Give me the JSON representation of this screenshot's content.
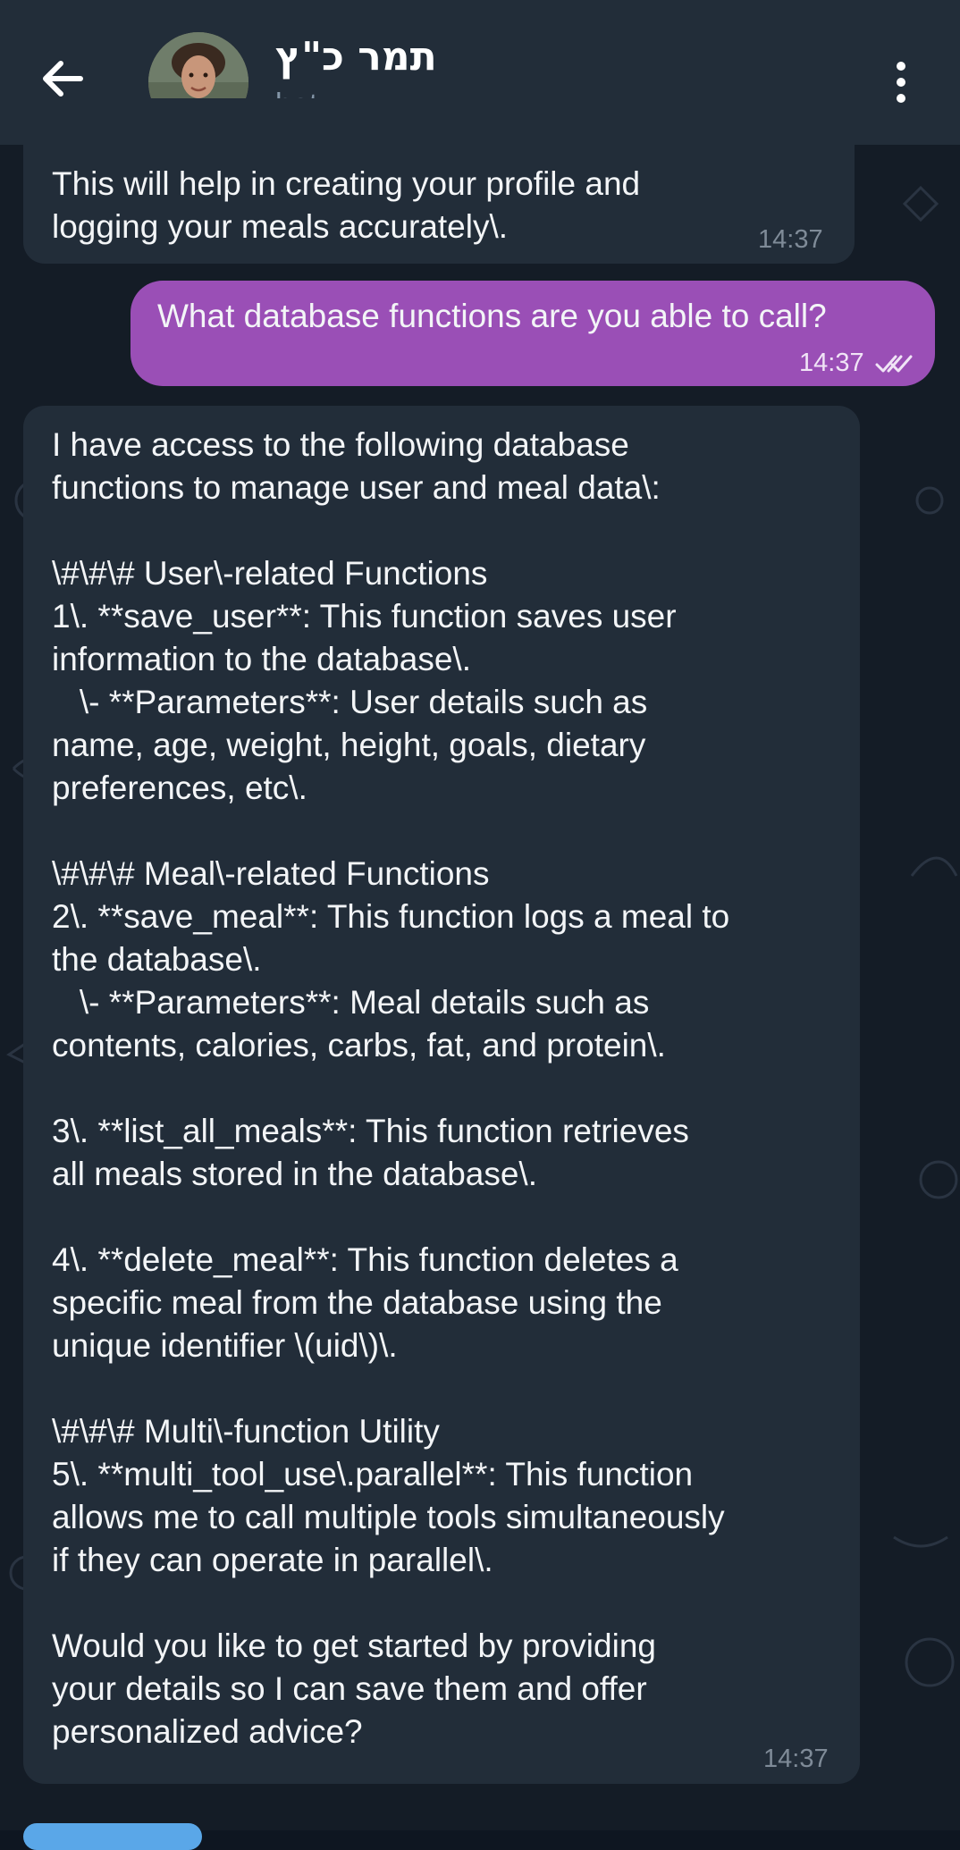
{
  "header": {
    "title": "תמר כ\"ץ",
    "subtitle": "bot"
  },
  "messages": [
    {
      "direction": "incoming",
      "lines": [
        "This will help in creating your profile and",
        "logging your meals accurately\\."
      ],
      "time": "14:37"
    },
    {
      "direction": "outgoing",
      "lines": [
        "What database functions are you able to call?"
      ],
      "time": "14:37",
      "status": "read"
    },
    {
      "direction": "incoming",
      "lines": [
        "I have access to the following database",
        "functions to manage user and meal data\\:",
        "",
        "\\#\\#\\# User\\-related Functions",
        "1\\. **save_user**: This function saves user",
        "information to the database\\.",
        "   \\- **Parameters**: User details such as",
        "name, age, weight, height, goals, dietary",
        "preferences, etc\\.",
        "",
        "\\#\\#\\# Meal\\-related Functions",
        "2\\. **save_meal**: This function logs a meal to",
        "the database\\.",
        "   \\- **Parameters**: Meal details such as",
        "contents, calories, carbs, fat, and protein\\.",
        "",
        "3\\. **list_all_meals**: This function retrieves",
        "all meals stored in the database\\.",
        "",
        "4\\. **delete_meal**: This function deletes a",
        "specific meal from the database using the",
        "unique identifier \\(uid\\)\\.",
        "",
        "\\#\\#\\# Multi\\-function Utility",
        "5\\. **multi_tool_use\\.parallel**: This function",
        "allows me to call multiple tools simultaneously",
        "if they can operate in parallel\\.",
        "",
        "Would you like to get started by providing",
        "your details so I can save them and offer",
        "personalized advice?"
      ],
      "time": "14:37"
    }
  ],
  "colors": {
    "header_bg": "#222d39",
    "incoming_bubble": "#222d39",
    "outgoing_bubble": "#9a4fb6",
    "chat_bg": "#141c26"
  },
  "icons": {
    "back": "arrow-left-icon",
    "menu": "more-vertical-icon",
    "read": "double-check-icon"
  }
}
